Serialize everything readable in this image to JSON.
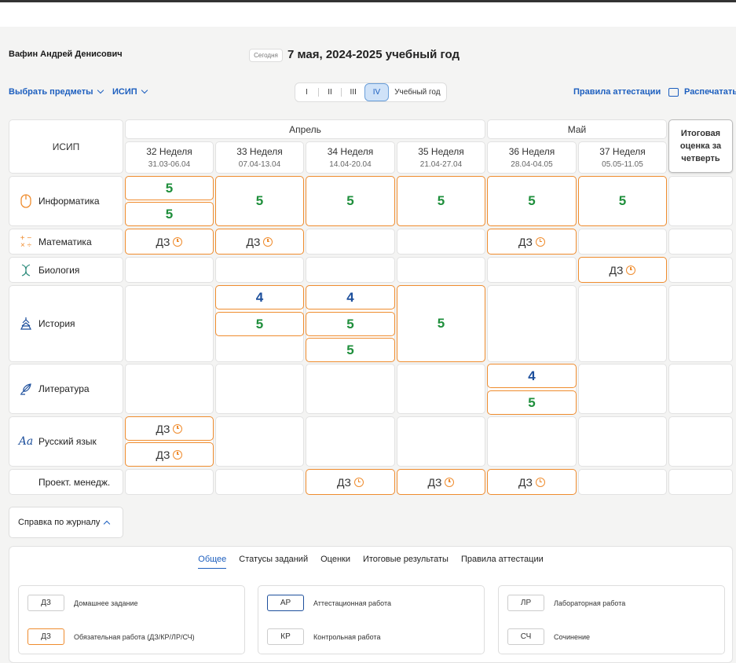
{
  "header": {
    "student_name": "Вафин Андрей Денисович",
    "today_label": "Сегодня",
    "date_title": "7 мая, 2024-2025 учебный год"
  },
  "toolbar": {
    "select_subjects": "Выбрать предметы",
    "group": "ИСИП",
    "periods": [
      "I",
      "II",
      "III",
      "IV",
      "Учебный год"
    ],
    "active_period": "IV",
    "attestation_rules": "Правила аттестации",
    "print": "Распечатать"
  },
  "table": {
    "corner_label": "ИСИП",
    "months": [
      "Апрель",
      "Май"
    ],
    "weeks": [
      {
        "name": "32 Неделя",
        "range": "31.03-06.04"
      },
      {
        "name": "33 Неделя",
        "range": "07.04-13.04"
      },
      {
        "name": "34 Неделя",
        "range": "14.04-20.04"
      },
      {
        "name": "35 Неделя",
        "range": "21.04-27.04"
      },
      {
        "name": "36 Неделя",
        "range": "28.04-04.05"
      },
      {
        "name": "37 Неделя",
        "range": "05.05-11.05"
      }
    ],
    "final_header": "Итоговая оценка за четверть",
    "subjects": [
      {
        "name": "Информатика",
        "icon": "mouse-icon"
      },
      {
        "name": "Математика",
        "icon": "math-symbols-icon"
      },
      {
        "name": "Биология",
        "icon": "dna-icon"
      },
      {
        "name": "История",
        "icon": "monument-icon"
      },
      {
        "name": "Литература",
        "icon": "quill-icon"
      },
      {
        "name": "Русский язык",
        "icon": "letters-icon"
      },
      {
        "name": "Проект. менедж.",
        "icon": ""
      }
    ],
    "grades": {
      "informatika": [
        [
          "5",
          "5"
        ],
        [
          "5"
        ],
        [
          "5"
        ],
        [
          "5"
        ],
        [
          "5"
        ],
        [
          "5"
        ]
      ],
      "matematika": [
        "ДЗ",
        "ДЗ",
        "",
        "",
        "ДЗ",
        ""
      ],
      "biologiya": [
        "",
        "",
        "",
        "",
        "",
        "ДЗ"
      ],
      "istoriya": [
        [],
        [
          "4",
          "5"
        ],
        [
          "4",
          "5",
          "5"
        ],
        [
          "5"
        ],
        [],
        []
      ],
      "literatura": [
        [],
        [],
        [],
        [],
        [
          "4",
          "5"
        ],
        []
      ],
      "russkiy": [
        [
          "ДЗ",
          "ДЗ"
        ],
        [],
        [],
        [],
        [],
        []
      ],
      "proekt": [
        "",
        "",
        "ДЗ",
        "ДЗ",
        "ДЗ",
        ""
      ]
    }
  },
  "journal_help": {
    "button": "Справка по журналу",
    "tabs": [
      "Общее",
      "Статусы заданий",
      "Оценки",
      "Итоговые результаты",
      "Правила аттестации"
    ],
    "active_tab": "Общее",
    "legend": [
      [
        {
          "tag": "ДЗ",
          "text": "Домашнее задание"
        },
        {
          "tag": "ДЗ",
          "text": "Обязательная работа (ДЗ/КР/ЛР/СЧ)"
        }
      ],
      [
        {
          "tag": "АР",
          "text": "Аттестационная работа"
        },
        {
          "tag": "КР",
          "text": "Контрольная работа"
        }
      ],
      [
        {
          "tag": "ЛР",
          "text": "Лабораторная работа"
        },
        {
          "tag": "СЧ",
          "text": "Сочинение"
        }
      ]
    ]
  },
  "colors": {
    "accent": "#1d5fbf",
    "grade5": "#1f8f3c",
    "grade4": "#1d4f9c",
    "required_border": "#ef8c2e"
  }
}
